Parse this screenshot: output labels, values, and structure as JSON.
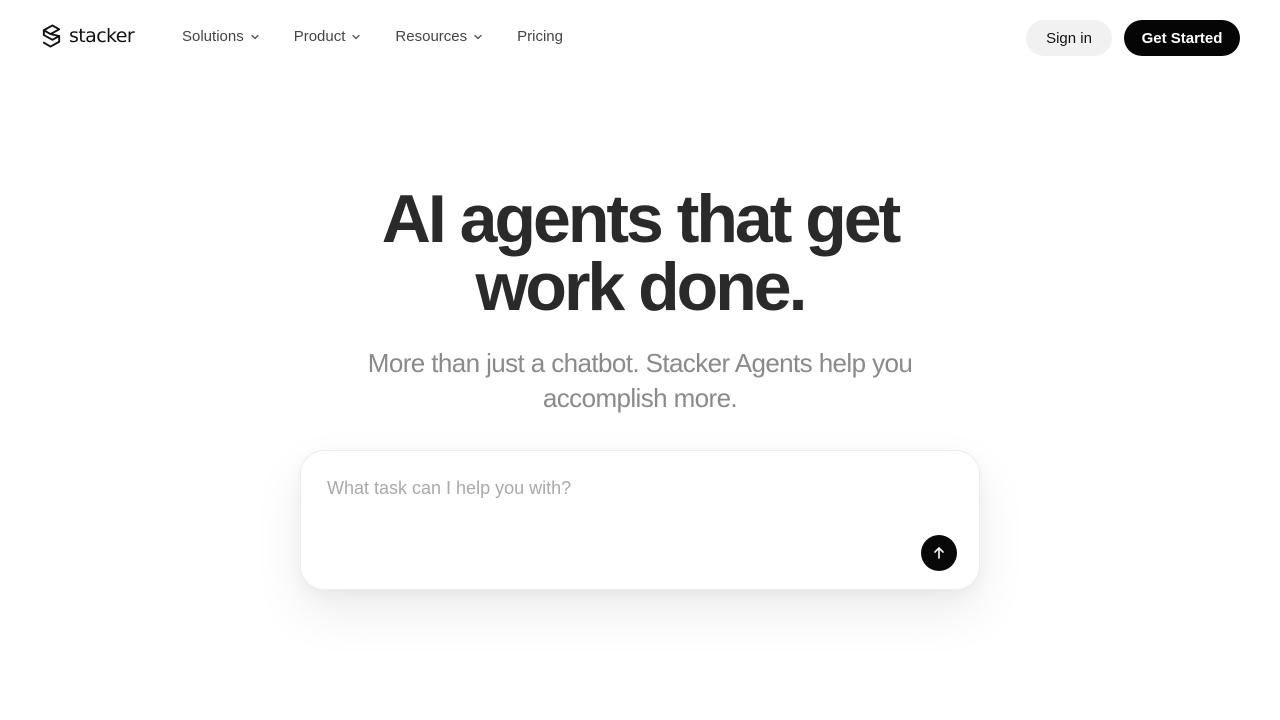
{
  "brand": {
    "name": "stacker",
    "logo_icon": "stacker-logo-icon"
  },
  "nav": {
    "items": [
      {
        "label": "Solutions",
        "has_dropdown": true
      },
      {
        "label": "Product",
        "has_dropdown": true
      },
      {
        "label": "Resources",
        "has_dropdown": true
      },
      {
        "label": "Pricing",
        "has_dropdown": false
      }
    ],
    "dropdown_icon": "chevron-down-icon"
  },
  "header_actions": {
    "sign_in_label": "Sign in",
    "get_started_label": "Get Started"
  },
  "hero": {
    "title_line1": "AI agents that get",
    "title_line2": "work done.",
    "subtitle": "More than just a chatbot. Stacker Agents help you accomplish more."
  },
  "prompt": {
    "placeholder": "What task can I help you with?",
    "value": "",
    "send_icon": "arrow-up-icon"
  },
  "colors": {
    "primary_button": "#050505",
    "secondary_button": "#f1f1f1",
    "title_text": "#2a2a2a",
    "subtitle_text": "#8a8a8a",
    "placeholder_text": "#a9a9a9"
  }
}
